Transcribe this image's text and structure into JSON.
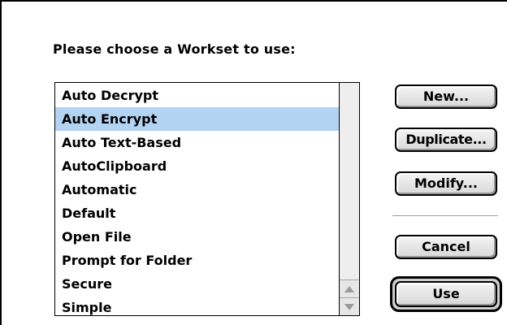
{
  "dialog": {
    "prompt": "Please choose a Workset to use:"
  },
  "worksets": {
    "items": [
      {
        "label": "Auto Decrypt",
        "selected": false
      },
      {
        "label": "Auto Encrypt",
        "selected": true
      },
      {
        "label": "Auto Text-Based",
        "selected": false
      },
      {
        "label": "AutoClipboard",
        "selected": false
      },
      {
        "label": "Automatic",
        "selected": false
      },
      {
        "label": "Default",
        "selected": false
      },
      {
        "label": "Open File",
        "selected": false
      },
      {
        "label": "Prompt for Folder",
        "selected": false
      },
      {
        "label": "Secure",
        "selected": false
      },
      {
        "label": "Simple",
        "selected": false
      }
    ],
    "selected_color": "#b3d3f3"
  },
  "scrollbar": {
    "up_icon": "scroll-up-arrow-icon",
    "down_icon": "scroll-down-arrow-icon"
  },
  "buttons": {
    "new": "New...",
    "duplicate": "Duplicate...",
    "modify": "Modify...",
    "cancel": "Cancel",
    "use": "Use"
  }
}
